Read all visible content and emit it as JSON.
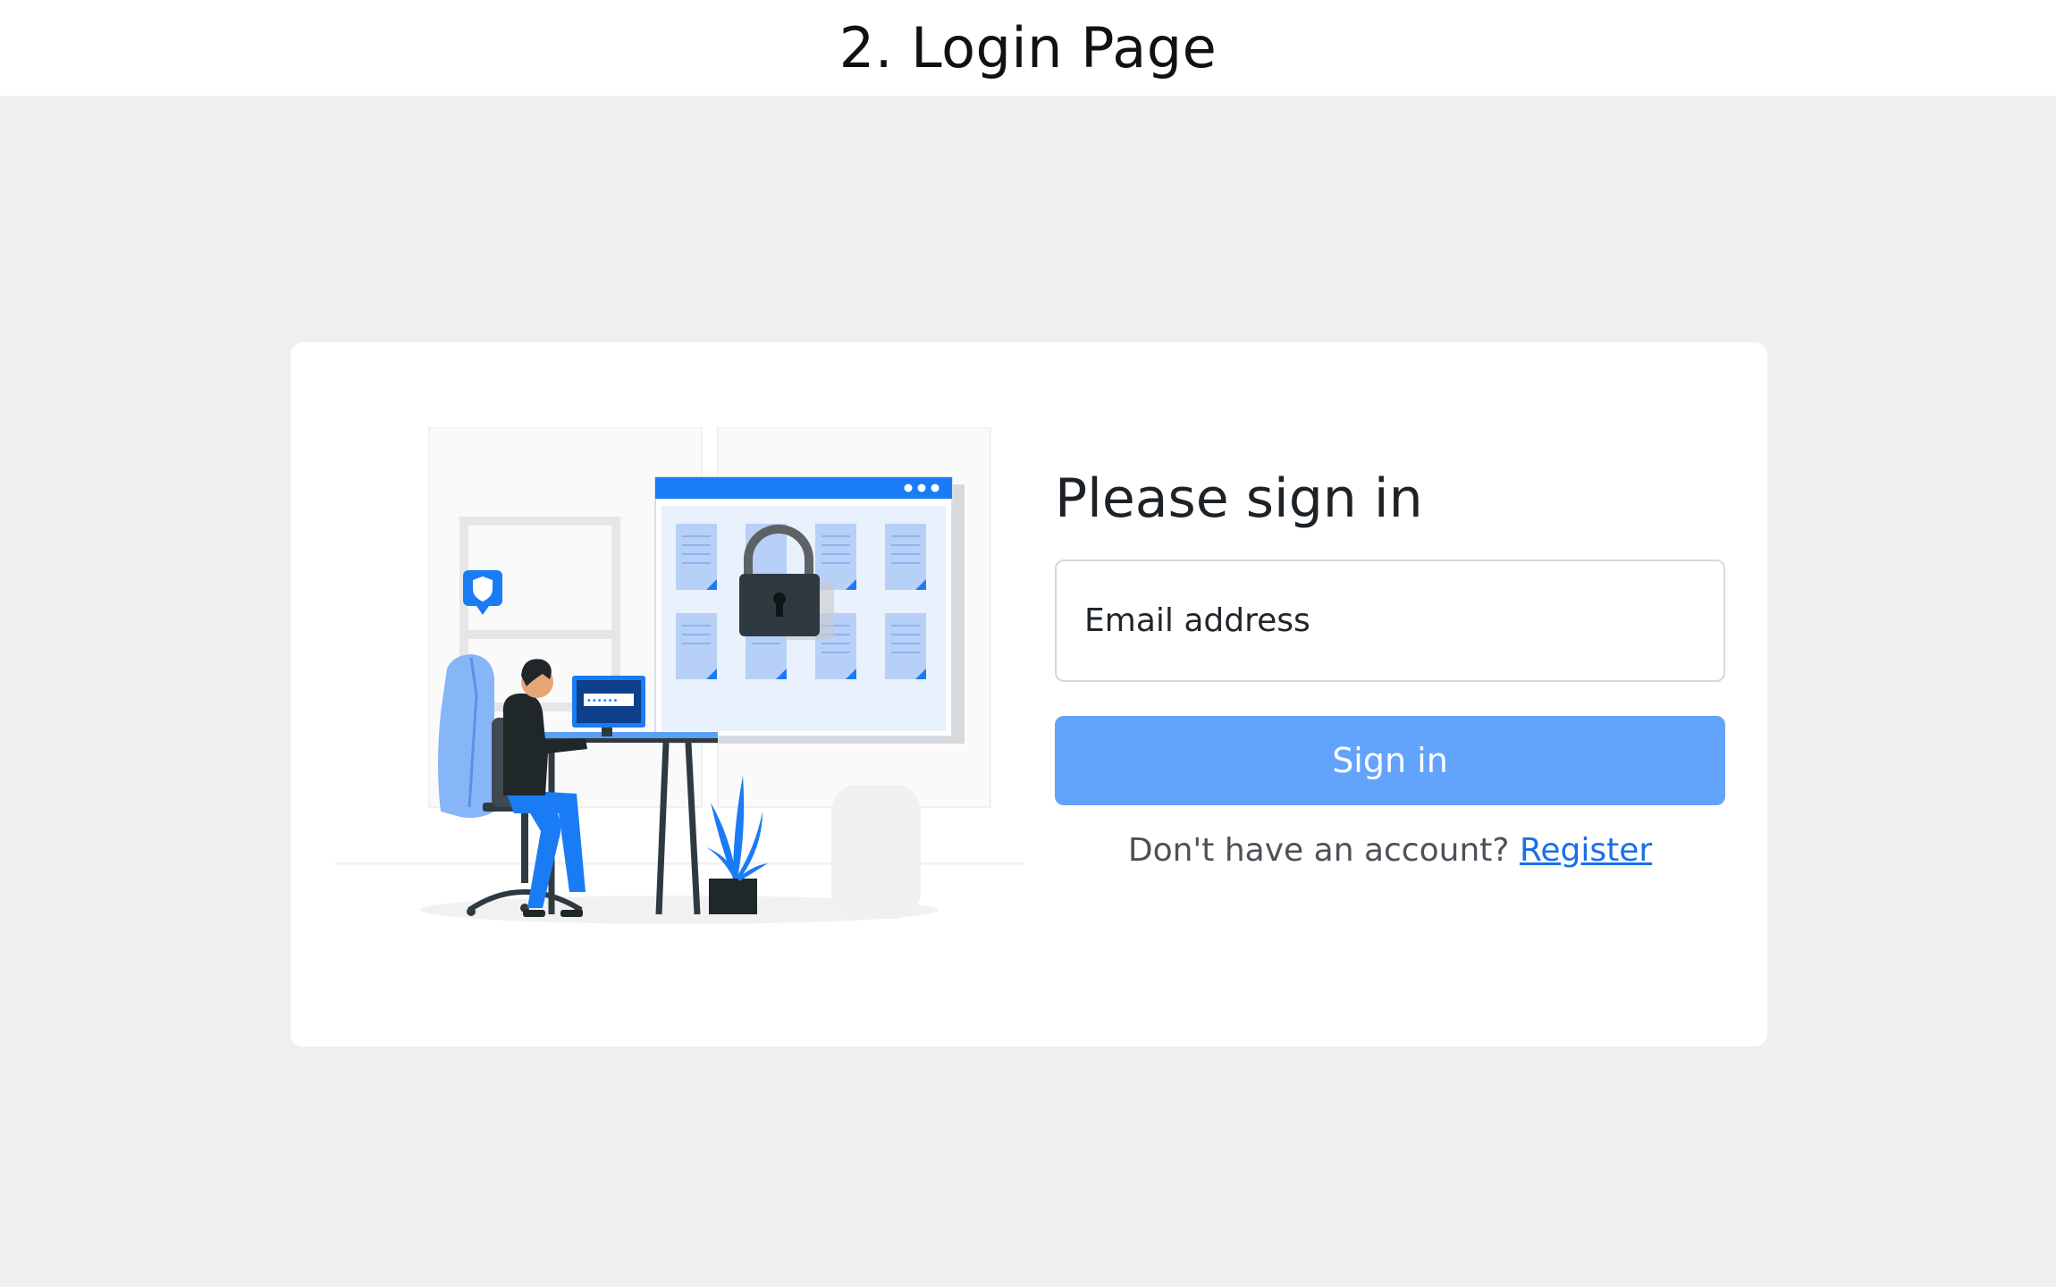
{
  "page_heading": "2. Login Page",
  "login": {
    "title": "Please sign in",
    "email_label": "Email address",
    "signin_label": "Sign in",
    "register_prompt": "Don't have an account?",
    "register_link": "Register"
  },
  "illustration": {
    "screen_text": "•••••• "
  },
  "colors": {
    "accent": "#62a3fc",
    "link": "#1a6fe8",
    "illustration_blue": "#1a7cf5",
    "background": "#efefef"
  }
}
